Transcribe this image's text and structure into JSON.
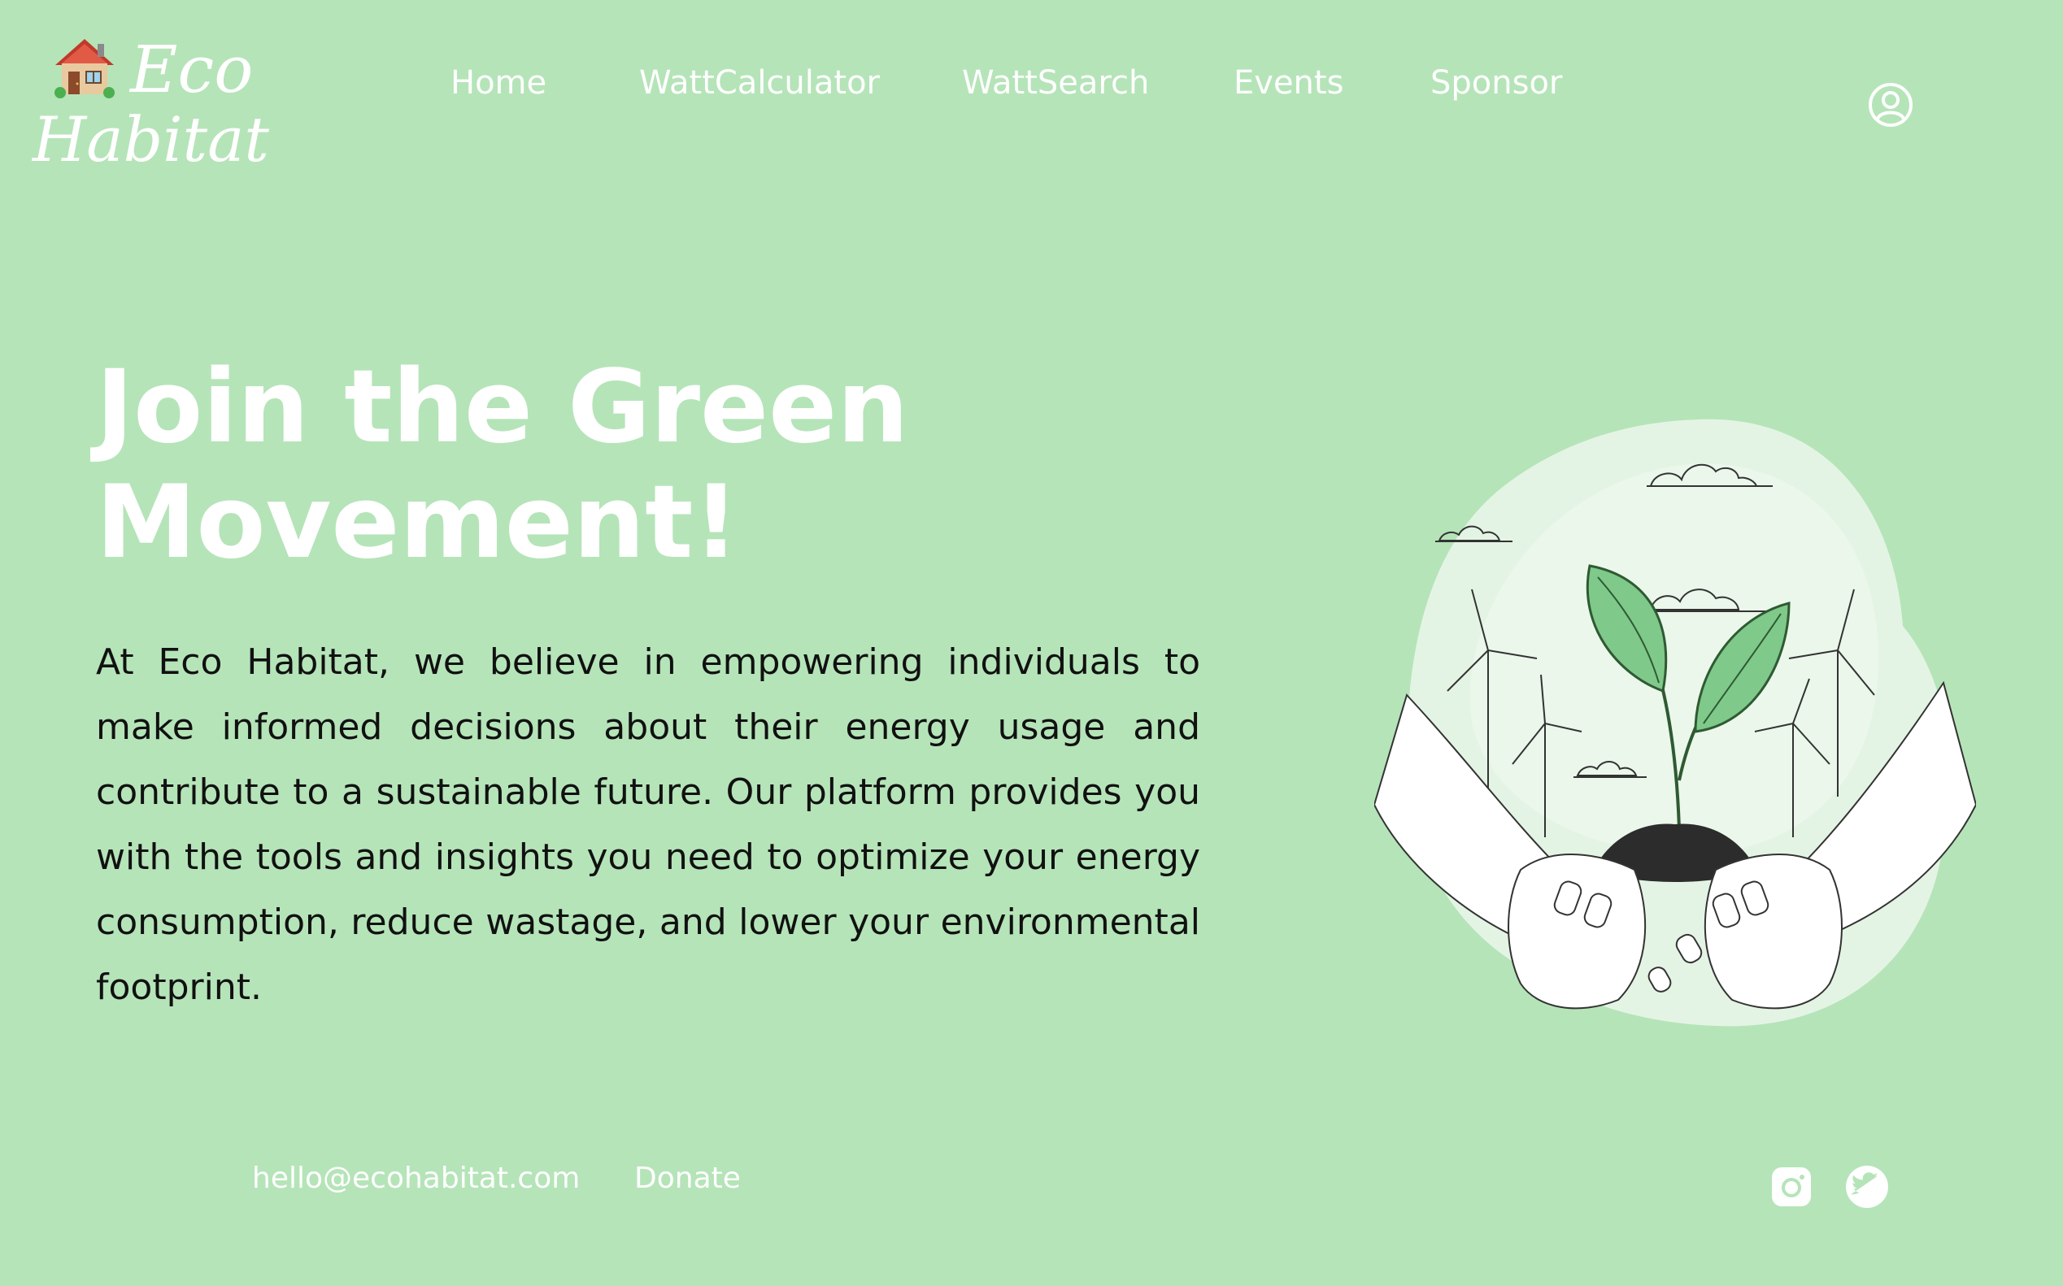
{
  "logo": {
    "line1": "Eco",
    "line2": "Habitat",
    "icon": "house-emoji-icon"
  },
  "nav": {
    "items": [
      {
        "label": "Home"
      },
      {
        "label": "WattCalculator"
      },
      {
        "label": "WattSearch"
      },
      {
        "label": "Events"
      },
      {
        "label": "Sponsor"
      }
    ]
  },
  "header": {
    "account_icon": "user-circle-icon"
  },
  "hero": {
    "title_line1": "Join the Green",
    "title_line2": "Movement!",
    "description": "At Eco Habitat, we believe in empowering individuals to make informed decisions about their energy usage and contribute to a sustainable future. Our platform provides you with the tools and insights you need to optimize your energy consumption, reduce wastage, and lower your environmental footprint.",
    "illustration": "hands-holding-sprout-with-wind-turbines"
  },
  "footer": {
    "email": "hello@ecohabitat.com",
    "donate": "Donate",
    "social_icons": [
      "instagram-icon",
      "twitter-icon"
    ]
  },
  "colors": {
    "background": "#b5e4b8",
    "text_light": "#ffffff",
    "text_dark": "#111111",
    "leaf": "#7fc98a"
  }
}
